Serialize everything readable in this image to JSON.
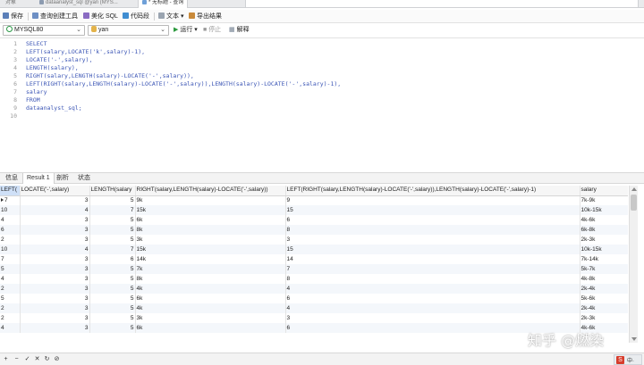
{
  "tabs": [
    {
      "label": "对象",
      "active": false
    },
    {
      "label": "dataanalyst_sql @yan (MYS...",
      "active": false
    },
    {
      "label": "* 无标题 - 查询",
      "active": true
    }
  ],
  "toolbar": {
    "save": "保存",
    "query_builder": "查询创建工具",
    "beautify": "美化 SQL",
    "snippet": "代码段",
    "text": "文本",
    "export": "导出结果"
  },
  "connection": {
    "server": "MYSQL80",
    "database": "yan",
    "run": "运行",
    "stop": "停止",
    "explain": "解释"
  },
  "editor": {
    "line_numbers": [
      "1",
      "2",
      "3",
      "4",
      "5",
      "6",
      "7",
      "8",
      "9",
      "10"
    ],
    "lines": [
      "SELECT",
      "LEFT(salary,LOCATE('k',salary)-1),",
      "LOCATE('-',salary),",
      "LENGTH(salary),",
      "RIGHT(salary,LENGTH(salary)-LOCATE('-',salary)),",
      "LEFT(RIGHT(salary,LENGTH(salary)-LOCATE('-',salary)),LENGTH(salary)-LOCATE('-',salary)-1),",
      "salary",
      "FROM",
      "dataanalyst_sql;",
      ""
    ]
  },
  "result_tabs": [
    "信息",
    "Result 1",
    "剖析",
    "状态"
  ],
  "grid": {
    "columns": [
      "LEFT(",
      "LOCATE('-',salary)",
      "LENGTH(salary",
      "RIGHT(salary,LENGTH(salary)-LOCATE('-',salary))",
      "LEFT(RIGHT(salary,LENGTH(salary)-LOCATE('-',salary)),LENGTH(salary)-LOCATE('-',salary)-1)",
      "salary"
    ],
    "rows": [
      [
        "7",
        "3",
        "5",
        "9k",
        "9",
        "7k-9k"
      ],
      [
        "10",
        "4",
        "7",
        "15k",
        "15",
        "10k-15k"
      ],
      [
        "4",
        "3",
        "5",
        "6k",
        "6",
        "4k-6k"
      ],
      [
        "6",
        "3",
        "5",
        "8k",
        "8",
        "6k-8k"
      ],
      [
        "2",
        "3",
        "5",
        "3k",
        "3",
        "2k-3k"
      ],
      [
        "10",
        "4",
        "7",
        "15k",
        "15",
        "10k-15k"
      ],
      [
        "7",
        "3",
        "6",
        "14k",
        "14",
        "7k-14k"
      ],
      [
        "5",
        "3",
        "5",
        "7k",
        "7",
        "5k-7k"
      ],
      [
        "4",
        "3",
        "5",
        "8k",
        "8",
        "4k-8k"
      ],
      [
        "2",
        "3",
        "5",
        "4k",
        "4",
        "2k-4k"
      ],
      [
        "5",
        "3",
        "5",
        "6k",
        "6",
        "5k-6k"
      ],
      [
        "2",
        "3",
        "5",
        "4k",
        "4",
        "2k-4k"
      ],
      [
        "2",
        "3",
        "5",
        "3k",
        "3",
        "2k-3k"
      ],
      [
        "4",
        "3",
        "5",
        "6k",
        "6",
        "4k-6k"
      ]
    ]
  },
  "bottom_controls": [
    "+",
    "−",
    "✓",
    "✕",
    "↻",
    "⊘"
  ],
  "watermark": "知乎 @燃染",
  "tray_label": "S",
  "tray_text": "中·"
}
